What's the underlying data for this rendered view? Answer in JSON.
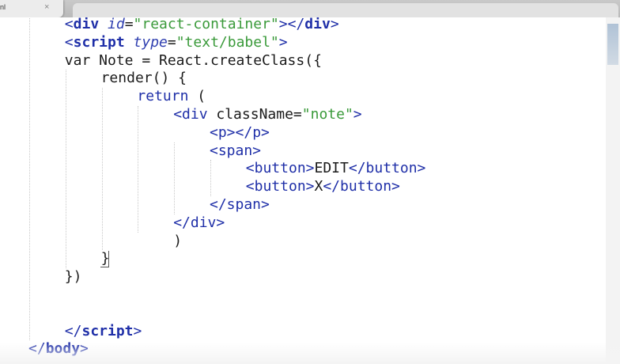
{
  "tab": {
    "label": "nl",
    "close_glyph": "×",
    "close_icon": "close-icon"
  },
  "code_lines": [
    {
      "indent": 1,
      "tokens": [
        [
          "tag",
          "<"
        ],
        [
          "tagb",
          "div"
        ],
        [
          "attr",
          " "
        ],
        [
          "attri",
          "id"
        ],
        [
          "txt",
          "="
        ],
        [
          "str",
          "\"react-container\""
        ],
        [
          "tag",
          ">"
        ],
        [
          "tag",
          "</"
        ],
        [
          "tagb",
          "div"
        ],
        [
          "tag",
          ">"
        ]
      ]
    },
    {
      "indent": 1,
      "tokens": [
        [
          "tag",
          "<"
        ],
        [
          "tagb",
          "script"
        ],
        [
          "txt",
          " "
        ],
        [
          "attri",
          "type"
        ],
        [
          "txt",
          "="
        ],
        [
          "str",
          "\"text/babel\""
        ],
        [
          "tag",
          ">"
        ]
      ]
    },
    {
      "indent": 1,
      "tokens": [
        [
          "txt",
          "var Note = React.createClass({"
        ]
      ]
    },
    {
      "indent": 2,
      "tokens": [
        [
          "txt",
          "render() {"
        ]
      ]
    },
    {
      "indent": 3,
      "tokens": [
        [
          "kw",
          "return"
        ],
        [
          "txt",
          " ("
        ]
      ]
    },
    {
      "indent": 4,
      "tokens": [
        [
          "tag",
          "<div"
        ],
        [
          "txt",
          " className="
        ],
        [
          "str",
          "\"note\""
        ],
        [
          "tag",
          ">"
        ]
      ]
    },
    {
      "indent": 5,
      "tokens": [
        [
          "tag",
          "<p>"
        ],
        [
          "tag",
          "</p>"
        ]
      ]
    },
    {
      "indent": 5,
      "tokens": [
        [
          "tag",
          "<span>"
        ]
      ]
    },
    {
      "indent": 6,
      "tokens": [
        [
          "tag",
          "<button>"
        ],
        [
          "txt",
          "EDIT"
        ],
        [
          "tag",
          "</button>"
        ]
      ]
    },
    {
      "indent": 6,
      "tokens": [
        [
          "tag",
          "<button>"
        ],
        [
          "txt",
          "X"
        ],
        [
          "tag",
          "</button>"
        ]
      ]
    },
    {
      "indent": 5,
      "tokens": [
        [
          "tag",
          "</span>"
        ]
      ]
    },
    {
      "indent": 4,
      "tokens": [
        [
          "tag",
          "</div>"
        ]
      ]
    },
    {
      "indent": 4,
      "tokens": [
        [
          "txt",
          ")"
        ]
      ]
    },
    {
      "indent": 2,
      "tokens": [
        [
          "txt",
          "}"
        ]
      ]
    },
    {
      "indent": 1,
      "tokens": [
        [
          "txt",
          "})"
        ]
      ]
    },
    {
      "indent": 0,
      "tokens": []
    },
    {
      "indent": 0,
      "tokens": []
    },
    {
      "indent": 1,
      "tokens": [
        [
          "tag",
          "</"
        ],
        [
          "tagb",
          "script"
        ],
        [
          "tag",
          ">"
        ]
      ]
    },
    {
      "indent": 0,
      "tokens": [
        [
          "tag",
          "</"
        ],
        [
          "tagb",
          "body"
        ],
        [
          "tag",
          ">"
        ]
      ]
    }
  ],
  "colors": {
    "tag": "#1f2fa8",
    "string": "#3a9a3a",
    "text": "#1b1b1b"
  }
}
